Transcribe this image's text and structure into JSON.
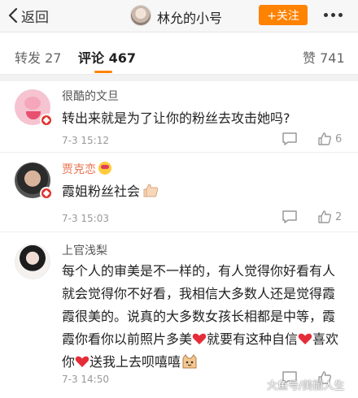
{
  "header": {
    "back_label": "返回",
    "title": "林允的小号",
    "follow_label": "+关注"
  },
  "tabs": {
    "repost": "转发 27",
    "comments": "评论 467",
    "likes": "赞 741"
  },
  "comments": [
    {
      "user": "很酷的文旦",
      "text": "转出来就是为了让你的粉丝去攻击她吗?",
      "time": "7-3 15:12",
      "likes": "6"
    },
    {
      "user": "贾克恋",
      "text": "霞姐粉丝社会",
      "time": "7-3 15:03",
      "likes": "2"
    },
    {
      "user": "上官浅梨",
      "text_1": "每个人的审美是不一样的，有人觉得你好看有人就会觉得你不好看，我相信大多数人还是觉得霞霞很美的。说真的大多数女孩长相都是中等，霞霞你看你以前照片多美",
      "text_2": "就要有这种自信",
      "text_3": "喜欢你",
      "text_4": "送我上去呗嘻嘻",
      "time": "7-3 14:50",
      "likes": ""
    }
  ],
  "watermark": "大鱼号/美丽人生",
  "colors": {
    "accent": "#ff8200",
    "vip_name": "#eb7350",
    "badge": "#e0332d"
  }
}
